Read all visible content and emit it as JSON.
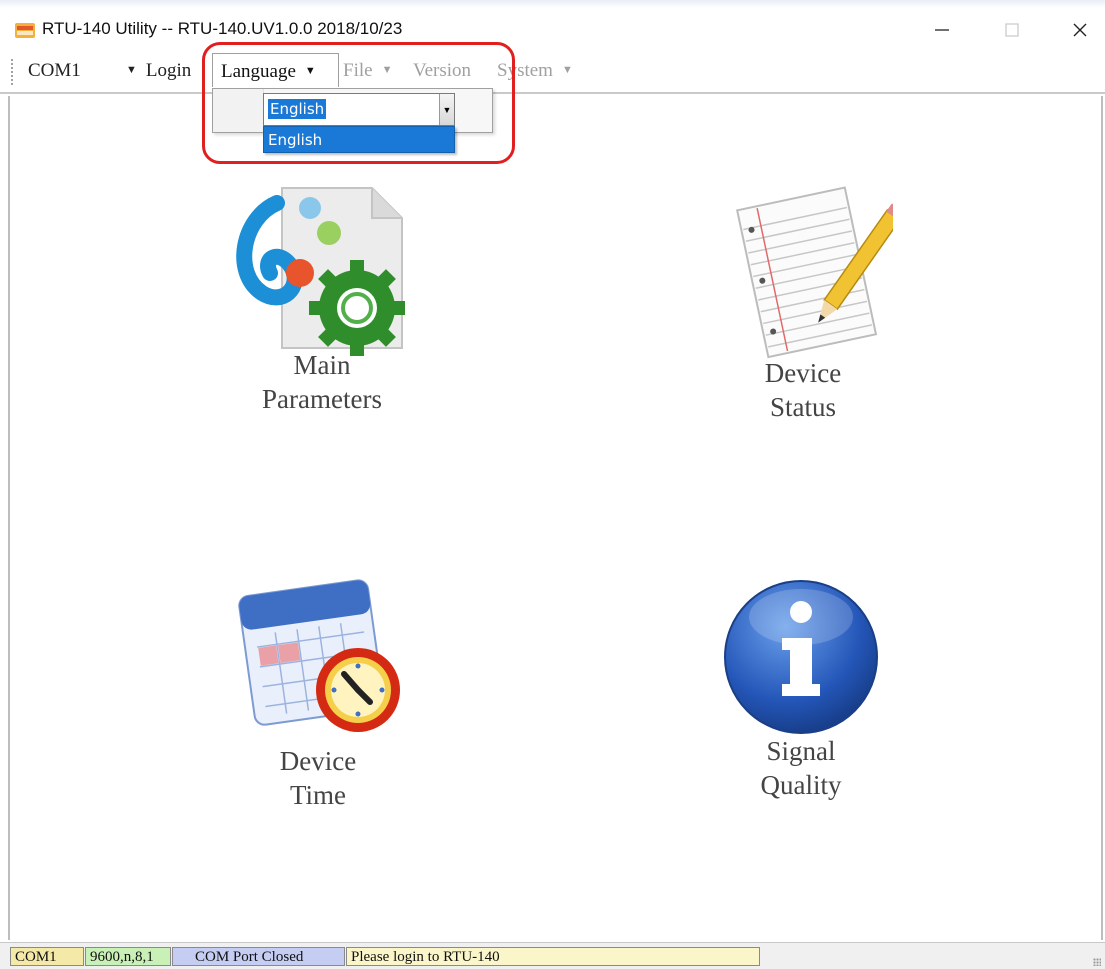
{
  "window": {
    "title": "RTU-140 Utility -- RTU-140.UV1.0.0 2018/10/23",
    "minimize_icon": "minimize-icon",
    "maximize_icon": "maximize-icon",
    "close_icon": "close-icon"
  },
  "menubar": {
    "com_port": "COM1",
    "login": "Login",
    "language": "Language",
    "file": "File",
    "version": "Version",
    "system": "System"
  },
  "language_dropdown": {
    "selected": "English",
    "options": [
      "English"
    ]
  },
  "tiles": [
    {
      "line1": "Main",
      "line2": "Parameters",
      "icon": "settings-gear-icon"
    },
    {
      "line1": "Device",
      "line2": "Status",
      "icon": "notepad-pencil-icon"
    },
    {
      "line1": "Device",
      "line2": "Time",
      "icon": "calendar-clock-icon"
    },
    {
      "line1": "Signal",
      "line2": "Quality",
      "icon": "info-icon"
    }
  ],
  "statusbar": {
    "port": "COM1",
    "settings": "9600,n,8,1",
    "port_state": "COM Port Closed",
    "message": "Please login to RTU-140"
  },
  "colors": {
    "highlight_ring": "#e0201f",
    "selection_blue": "#1a78d6",
    "status_port": "#f5e9a8",
    "status_settings": "#c9f0b6",
    "status_state": "#c5cdf3",
    "status_message": "#fbf6c9"
  }
}
